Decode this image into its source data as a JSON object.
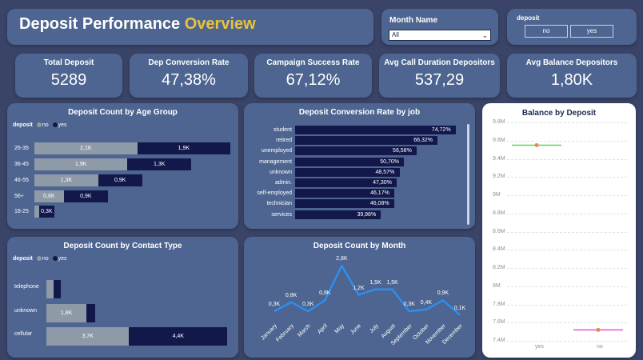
{
  "header": {
    "title_main": "Deposit Performance",
    "title_accent": "Overview"
  },
  "month_filter": {
    "label": "Month Name",
    "selected": "All"
  },
  "deposit_filter": {
    "label": "deposit",
    "options": [
      "no",
      "yes"
    ]
  },
  "kpis": [
    {
      "title": "Total Deposit",
      "value": "5289"
    },
    {
      "title": "Dep Conversion Rate",
      "value": "47,38%"
    },
    {
      "title": "Campaign Success Rate",
      "value": "67,12%"
    },
    {
      "title": "Avg Call Duration Depositors",
      "value": "537,29"
    },
    {
      "title": "Avg Balance Depositors",
      "value": "1,80K"
    }
  ],
  "colors": {
    "background": "#3a4468",
    "panel": "#4d6590",
    "no": "#8f9aa8",
    "yes": "#12184a",
    "accent": "#e8c33d",
    "line": "#2e8ef0"
  },
  "age_chart": {
    "title": "Deposit Count by Age Group",
    "legend_label": "deposit",
    "legend_items": [
      "no",
      "yes"
    ],
    "rows": [
      {
        "label": "26-35",
        "no": 2100,
        "yes": 1900,
        "no_text": "2,1K",
        "yes_text": "1,9K"
      },
      {
        "label": "36-45",
        "no": 1900,
        "yes": 1300,
        "no_text": "1,9K",
        "yes_text": "1,3K"
      },
      {
        "label": "46-55",
        "no": 1300,
        "yes": 900,
        "no_text": "1,3K",
        "yes_text": "0,9K"
      },
      {
        "label": "56+",
        "no": 600,
        "yes": 900,
        "no_text": "0,6K",
        "yes_text": "0,9K"
      },
      {
        "label": "18-25",
        "no": 100,
        "yes": 300,
        "no_text": "",
        "yes_text": "0,3K"
      }
    ]
  },
  "job_chart": {
    "title": "Deposit Conversion Rate by job",
    "rows": [
      {
        "label": "student",
        "value": 74.72,
        "text": "74,72%"
      },
      {
        "label": "retired",
        "value": 66.32,
        "text": "66,32%"
      },
      {
        "label": "unemployed",
        "value": 56.58,
        "text": "56,58%"
      },
      {
        "label": "management",
        "value": 50.7,
        "text": "50,70%"
      },
      {
        "label": "unknown",
        "value": 48.57,
        "text": "48,57%"
      },
      {
        "label": "admin.",
        "value": 47.3,
        "text": "47,30%"
      },
      {
        "label": "self-employed",
        "value": 46.17,
        "text": "46,17%"
      },
      {
        "label": "technician",
        "value": 46.08,
        "text": "46,08%"
      },
      {
        "label": "services",
        "value": 39.98,
        "text": "39,98%"
      }
    ]
  },
  "balance_chart": {
    "title": "Balance by Deposit",
    "y_ticks": [
      "9.8M",
      "9.6M",
      "9.4M",
      "9.2M",
      "9M",
      "8.8M",
      "8.6M",
      "8.4M",
      "8.2M",
      "8M",
      "7.8M",
      "7.6M",
      "7.4M"
    ],
    "y_min": 7.4,
    "y_max": 9.8,
    "categories": [
      "yes",
      "no"
    ],
    "values": [
      9.55,
      7.52
    ]
  },
  "contact_chart": {
    "title": "Deposit Count by Contact Type",
    "legend_label": "deposit",
    "legend_items": [
      "no",
      "yes"
    ],
    "rows": [
      {
        "label": "telephone",
        "no": 300,
        "yes": 300,
        "no_text": "",
        "yes_text": ""
      },
      {
        "label": "unknown",
        "no": 1800,
        "yes": 400,
        "no_text": "1,8K",
        "yes_text": ""
      },
      {
        "label": "cellular",
        "no": 3700,
        "yes": 4400,
        "no_text": "3,7K",
        "yes_text": "4,4K"
      }
    ]
  },
  "month_chart": {
    "title": "Deposit Count by Month",
    "categories": [
      "January",
      "February",
      "March",
      "April",
      "May",
      "June",
      "July",
      "August",
      "September",
      "October",
      "November",
      "December"
    ],
    "values": [
      0.3,
      0.8,
      0.3,
      0.9,
      2.8,
      1.2,
      1.5,
      1.5,
      0.3,
      0.4,
      0.9,
      0.1
    ],
    "labels": [
      "0,3K",
      "0,8K",
      "0,3K",
      "0,9K",
      "2,8K",
      "1,2K",
      "1,5K",
      "1,5K",
      "0,3K",
      "0,4K",
      "0,9K",
      "0,1K"
    ]
  },
  "chart_data": [
    {
      "type": "bar",
      "title": "Deposit Count by Age Group",
      "categories": [
        "26-35",
        "36-45",
        "46-55",
        "56+",
        "18-25"
      ],
      "series": [
        {
          "name": "no",
          "values": [
            2100,
            1900,
            1300,
            600,
            100
          ]
        },
        {
          "name": "yes",
          "values": [
            1900,
            1300,
            900,
            900,
            300
          ]
        }
      ]
    },
    {
      "type": "bar",
      "title": "Deposit Conversion Rate by job",
      "categories": [
        "student",
        "retired",
        "unemployed",
        "management",
        "unknown",
        "admin.",
        "self-employed",
        "technician",
        "services"
      ],
      "values": [
        74.72,
        66.32,
        56.58,
        50.7,
        48.57,
        47.3,
        46.17,
        46.08,
        39.98
      ]
    },
    {
      "type": "scatter",
      "title": "Balance by Deposit",
      "categories": [
        "yes",
        "no"
      ],
      "values": [
        9550000,
        7520000
      ],
      "ylim": [
        7400000,
        9800000
      ]
    },
    {
      "type": "bar",
      "title": "Deposit Count by Contact Type",
      "categories": [
        "telephone",
        "unknown",
        "cellular"
      ],
      "series": [
        {
          "name": "no",
          "values": [
            300,
            1800,
            3700
          ]
        },
        {
          "name": "yes",
          "values": [
            300,
            400,
            4400
          ]
        }
      ]
    },
    {
      "type": "line",
      "title": "Deposit Count by Month",
      "categories": [
        "January",
        "February",
        "March",
        "April",
        "May",
        "June",
        "July",
        "August",
        "September",
        "October",
        "November",
        "December"
      ],
      "values": [
        300,
        800,
        300,
        900,
        2800,
        1200,
        1500,
        1500,
        300,
        400,
        900,
        100
      ]
    }
  ]
}
